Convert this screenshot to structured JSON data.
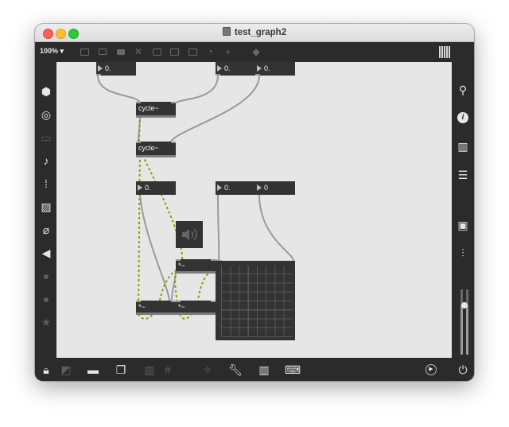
{
  "window": {
    "title": "test_graph2"
  },
  "toolbar": {
    "zoom_label": "100%",
    "icons": [
      "presentation-mode-icon",
      "patch-cord-icon",
      "comment-icon",
      "toggle-icon",
      "button-icon",
      "message-icon",
      "number-box-icon",
      "dial-icon",
      "new-object-icon",
      "paint-bucket-icon",
      "grid-view-icon"
    ]
  },
  "left_sidebar": {
    "icons": [
      "object-icon",
      "target-icon",
      "tape-icon",
      "music-note-icon",
      "sequence-icon",
      "image-icon",
      "paperclip-icon",
      "plugin-icon",
      "vst-icon",
      "info-b-icon",
      "star-icon"
    ]
  },
  "right_sidebar": {
    "icons": [
      "search-icon",
      "info-icon",
      "reference-book-icon",
      "list-icon",
      "snapshot-camera-icon",
      "mixer-icon",
      "volume-slider"
    ]
  },
  "bottom_bar": {
    "icons": [
      "lock-icon",
      "present-icon",
      "presentation-screen-icon",
      "windows-icon",
      "layout-icon",
      "grid-icon",
      "debug-wand-icon",
      "wrench-icon",
      "piano-icon",
      "keyboard-icon",
      "play-dsp-icon",
      "power-icon"
    ]
  },
  "patch": {
    "numbox_top_left": "0.",
    "numbox_top_mid": "0.",
    "numbox_top_right": "0.",
    "cycle1": "cycle~",
    "cycle2": "cycle~",
    "numbox_mid_left": "0.",
    "numbox_mid_mid": "0.",
    "numbox_mid_right": "0",
    "mult_top": "*~",
    "mult_bottom_left": "*~",
    "mult_bottom_right": "*~"
  }
}
